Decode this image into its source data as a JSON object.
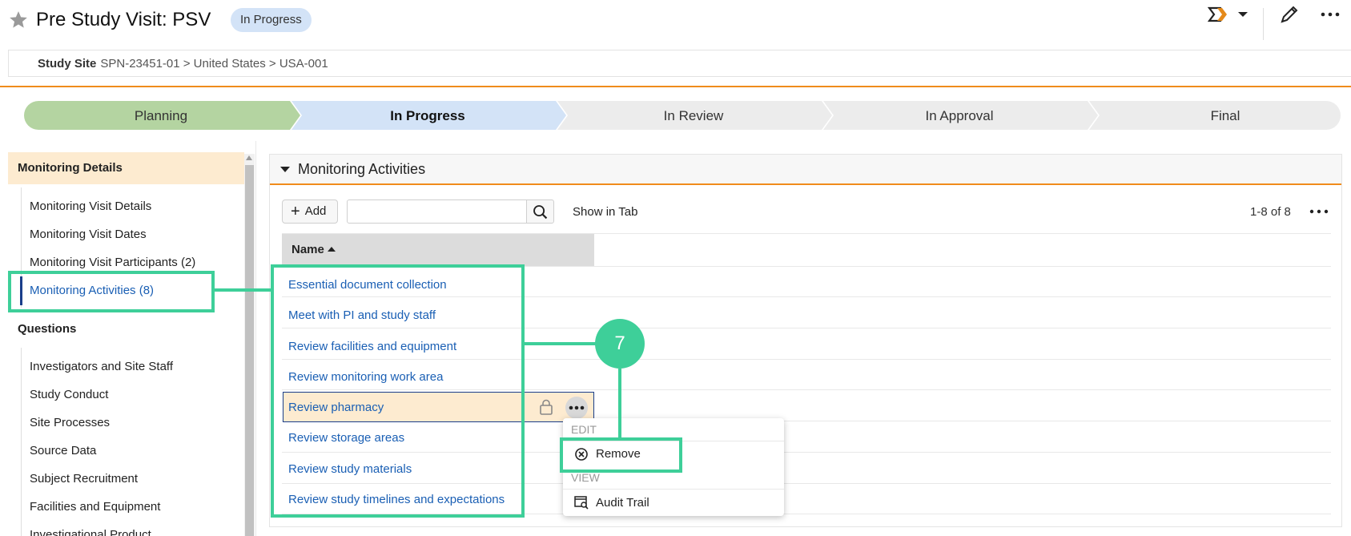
{
  "header": {
    "title": "Pre Study Visit: PSV",
    "status_badge": "In Progress",
    "breadcrumb_label": "Study Site",
    "breadcrumb_path": "SPN-23451-01 > United States > USA-001"
  },
  "stages": [
    {
      "label": "Planning",
      "state": "done",
      "color": "#b4d4a1"
    },
    {
      "label": "In Progress",
      "state": "current",
      "color": "#d3e3f7"
    },
    {
      "label": "In Review",
      "state": "future",
      "color": "#ececec"
    },
    {
      "label": "In Approval",
      "state": "future",
      "color": "#ececec"
    },
    {
      "label": "Final",
      "state": "future",
      "color": "#ececec"
    }
  ],
  "sidebar": {
    "section1": "Monitoring Details",
    "items1": [
      "Monitoring Visit Details",
      "Monitoring Visit Dates",
      "Monitoring Visit Participants (2)",
      "Monitoring Activities (8)"
    ],
    "section2": "Questions",
    "items2": [
      "Investigators and Site Staff",
      "Study Conduct",
      "Site Processes",
      "Source Data",
      "Subject Recruitment",
      "Facilities and Equipment",
      "Investigational Product"
    ]
  },
  "panel": {
    "title": "Monitoring Activities",
    "add_label": "Add",
    "search_value": "",
    "show_in_tab": "Show in Tab",
    "count": "1-8 of 8",
    "name_header": "Name",
    "rows": [
      "Essential document collection",
      "Meet with PI and study staff",
      "Review facilities and equipment",
      "Review monitoring work area",
      "Review pharmacy",
      "Review storage areas",
      "Review study materials",
      "Review study timelines and expectations"
    ]
  },
  "menu": {
    "edit_label": "EDIT",
    "remove_label": "Remove",
    "view_label": "VIEW",
    "audit_label": "Audit Trail"
  },
  "annotation": {
    "step_number": "7",
    "color": "#3ecf99"
  }
}
